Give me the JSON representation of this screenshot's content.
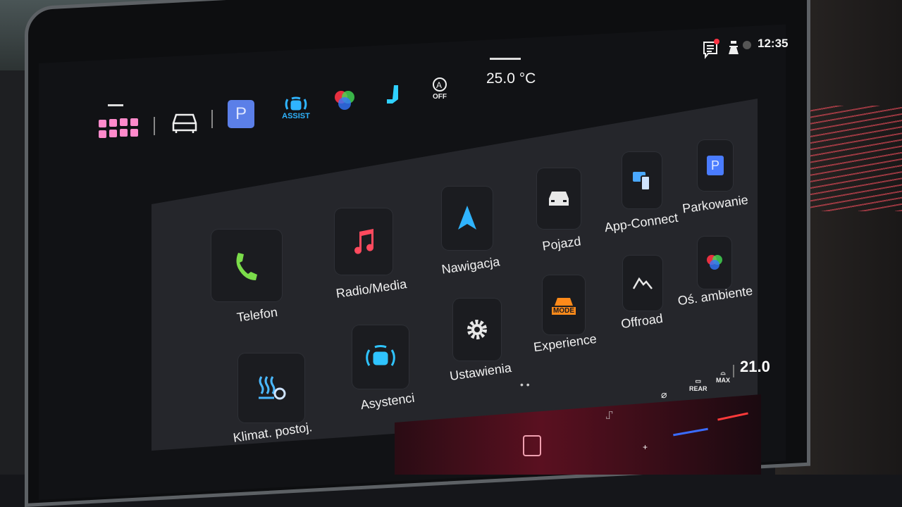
{
  "status_bar": {
    "time": "12:35",
    "cabin_temp": "25.0 °C",
    "icons": [
      "apps-grid-icon",
      "car-icon",
      "parking-icon",
      "assist-icon",
      "ambient-light-icon",
      "seat-heating-icon",
      "auto-hold-off-icon",
      "notification-icon",
      "user-icon",
      "profile-icon"
    ],
    "assist_label": "ASSIST",
    "parking_label": "P",
    "auto_off_label": "OFF"
  },
  "apps": [
    {
      "label": "Telefon",
      "icon": "phone-icon",
      "color": "#7bdc4a"
    },
    {
      "label": "Radio/Media",
      "icon": "music-note-icon",
      "color": "#ff4a5e"
    },
    {
      "label": "Nawigacja",
      "icon": "navigation-arrow-icon",
      "color": "#2fb4ff"
    },
    {
      "label": "Pojazd",
      "icon": "car-icon",
      "color": "#e8e8e8"
    },
    {
      "label": "App-Connect",
      "icon": "app-connect-icon",
      "color": "#4aa8ff"
    },
    {
      "label": "Parkowanie",
      "icon": "parking-icon",
      "color": "#4a7cff"
    },
    {
      "label": "Klimat. postoj.",
      "icon": "parking-heater-icon",
      "color": "#4ab8ff"
    },
    {
      "label": "Asystenci",
      "icon": "assist-icon",
      "color": "#2fc4ff"
    },
    {
      "label": "Ustawienia",
      "icon": "gear-icon",
      "color": "#e8e8e8"
    },
    {
      "label": "Experience",
      "icon": "drive-mode-icon",
      "color": "#ff8a1a",
      "icon_text": "MODE"
    },
    {
      "label": "Offroad",
      "icon": "mountain-icon",
      "color": "#e8e8e8"
    },
    {
      "label": "Oś. ambiente",
      "icon": "ambient-light-icon",
      "color": "#ff4a4a"
    }
  ],
  "page_indicator": "• •",
  "climate_bar": {
    "temp_right": "21.0",
    "rear_label": "REAR",
    "max_label": "MAX",
    "plus": "+"
  }
}
